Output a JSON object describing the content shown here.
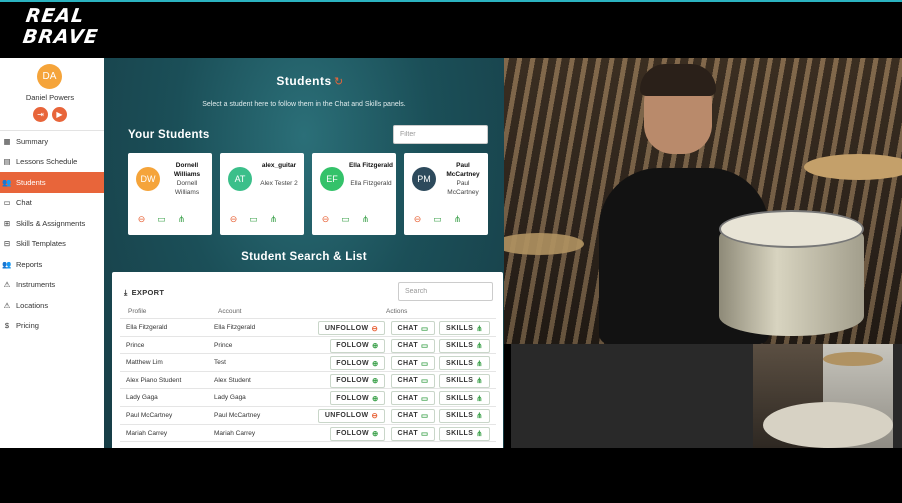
{
  "brand": {
    "logo_line1": "REAL",
    "logo_line2": "BRAVE"
  },
  "colors": {
    "accent": "#e8653a",
    "teal": "#1b4f58",
    "success": "#3aa049"
  },
  "user": {
    "initials": "DA",
    "name": "Daniel Powers",
    "logout_icon": "logout-icon",
    "video_icon": "video-camera-icon"
  },
  "nav": [
    {
      "icon": "grid-icon",
      "glyph": "▦",
      "label": "Summary"
    },
    {
      "icon": "calendar-icon",
      "glyph": "▤",
      "label": "Lessons Schedule"
    },
    {
      "icon": "people-icon",
      "glyph": "👥",
      "label": "Students"
    },
    {
      "icon": "chat-icon",
      "glyph": "▭",
      "label": "Chat"
    },
    {
      "icon": "skills-icon",
      "glyph": "⊞",
      "label": "Skills & Assignments"
    },
    {
      "icon": "template-icon",
      "glyph": "⊟",
      "label": "Skill Templates"
    },
    {
      "icon": "reports-icon",
      "glyph": "👥",
      "label": "Reports"
    },
    {
      "icon": "warning-icon",
      "glyph": "⚠",
      "label": "Instruments"
    },
    {
      "icon": "warning-icon",
      "glyph": "⚠",
      "label": "Locations"
    },
    {
      "icon": "dollar-icon",
      "glyph": "$",
      "label": "Pricing"
    }
  ],
  "students_panel": {
    "title": "Students",
    "subtitle": "Select a student here to follow them in the Chat and Skills panels.",
    "your_students_title": "Your Students",
    "filter_placeholder": "Filter",
    "cards": [
      {
        "initials": "DW",
        "color": "#f5a43a",
        "name": "Dornell Williams",
        "account": "Dornell Williams"
      },
      {
        "initials": "AT",
        "color": "#3bbf8a",
        "name": "alex_guitar",
        "account": "Alex Tester 2"
      },
      {
        "initials": "EF",
        "color": "#34c26a",
        "name": "Ella Fitzgerald",
        "account": "Ella Fitzgerald"
      },
      {
        "initials": "PM",
        "color": "#2d4a5c",
        "name": "Paul McCartney",
        "account": "Paul McCartney"
      }
    ],
    "search_list_title": "Student Search & List",
    "export_label": "EXPORT",
    "search_placeholder": "Search",
    "columns": {
      "profile": "Profile",
      "account": "Account",
      "actions": "Actions"
    },
    "labels": {
      "follow": "FOLLOW",
      "unfollow": "UNFOLLOW",
      "chat": "CHAT",
      "skills": "SKILLS"
    },
    "rows": [
      {
        "profile": "Ella Fitzgerald",
        "account": "Ella Fitzgerald",
        "following": true
      },
      {
        "profile": "Prince",
        "account": "Prince",
        "following": false
      },
      {
        "profile": "Matthew Lim",
        "account": "Test",
        "following": false
      },
      {
        "profile": "Alex Piano Student",
        "account": "Alex Student",
        "following": false
      },
      {
        "profile": "Lady Gaga",
        "account": "Lady Gaga",
        "following": false
      },
      {
        "profile": "Paul McCartney",
        "account": "Paul McCartney",
        "following": true
      },
      {
        "profile": "Mariah Carrey",
        "account": "Mariah Carrey",
        "following": false
      }
    ]
  }
}
